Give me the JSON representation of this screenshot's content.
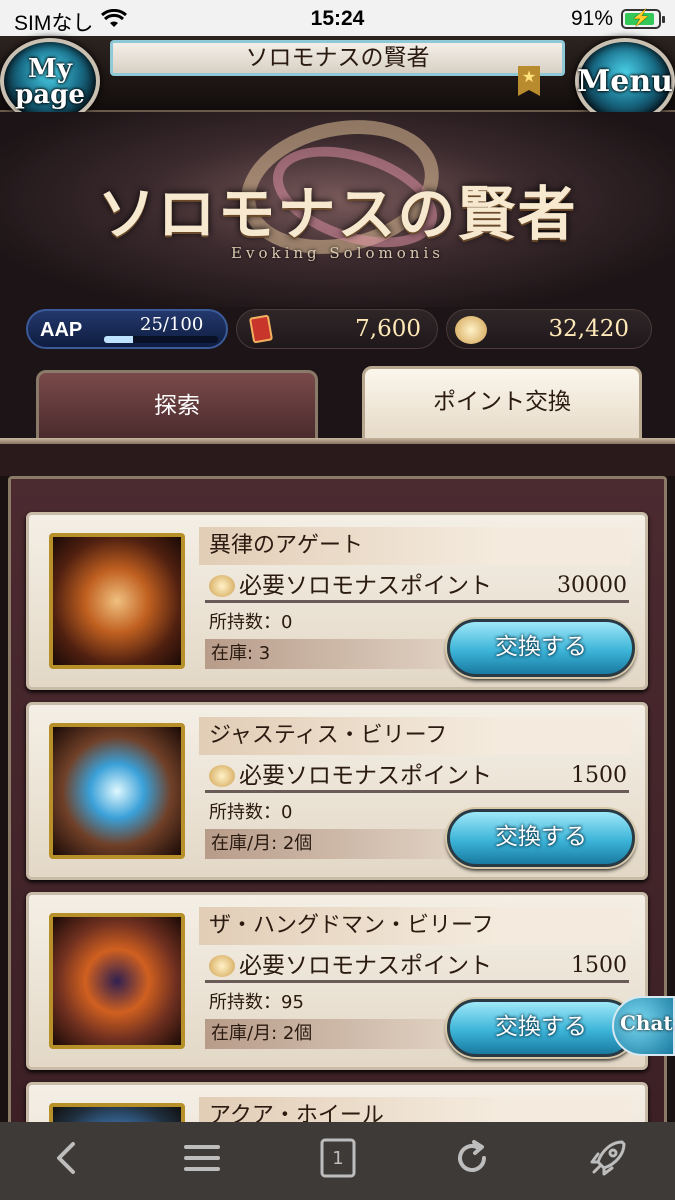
{
  "status_bar": {
    "carrier": "SIMなし",
    "time": "15:24",
    "battery": "91%",
    "battery_level": 0.91
  },
  "header": {
    "left_button": "My page",
    "left_line1": "My",
    "left_line2": "page",
    "title": "ソロモナスの賢者",
    "right_button": "Menu"
  },
  "banner": {
    "logo": "ソロモナスの賢者",
    "subtitle": "Evoking Solomonis"
  },
  "resources": {
    "aap_label": "AAP",
    "aap_value": "25/100",
    "aap_fraction": 0.25,
    "tickets": "7,600",
    "points": "32,420"
  },
  "tabs": [
    {
      "label": "探索",
      "active": false
    },
    {
      "label": "ポイント交換",
      "active": true
    }
  ],
  "items": [
    {
      "name": "異律のアゲート",
      "cost_label": "必要ソロモナスポイント",
      "cost": "30000",
      "owned": "所持数：0",
      "stock": "在庫: 3",
      "button": "交換する"
    },
    {
      "name": "ジャスティス・ビリーフ",
      "cost_label": "必要ソロモナスポイント",
      "cost": "1500",
      "owned": "所持数：0",
      "stock": "在庫/月: 2個",
      "button": "交換する"
    },
    {
      "name": "ザ・ハングドマン・ビリーフ",
      "cost_label": "必要ソロモナスポイント",
      "cost": "1500",
      "owned": "所持数：95",
      "stock": "在庫/月: 2個",
      "button": "交換する"
    },
    {
      "name": "アクア・ホイール"
    }
  ],
  "chat_label": "Chat",
  "browser_bar": {
    "tab_count": "1",
    "icons": [
      "back-icon",
      "menu-icon",
      "tabs-icon",
      "reload-icon",
      "rocket-icon"
    ]
  },
  "colors": {
    "exchange_button": "#3cb4d8",
    "active_tab": "#fbf6ec",
    "inactive_tab": "#7a4a4a",
    "panel": "#4b2a30",
    "battery_green": "#34c759"
  }
}
